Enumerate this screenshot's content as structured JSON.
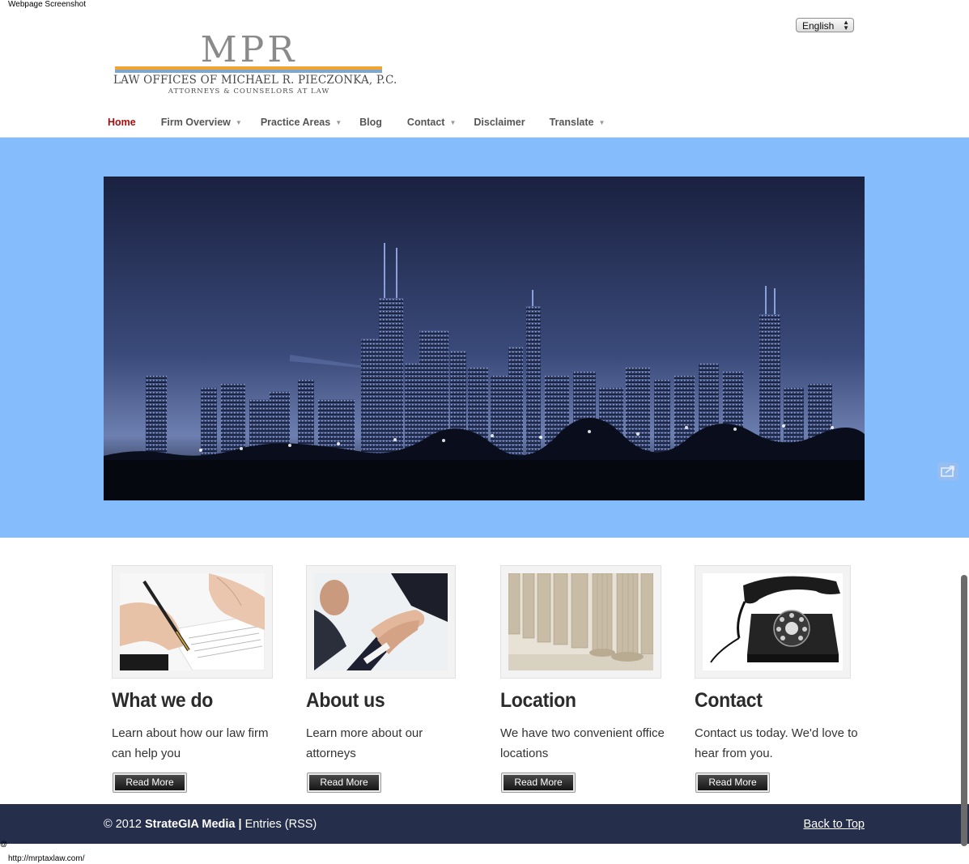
{
  "window": {
    "caption": "Webpage Screenshot",
    "url": "http://mrptaxlaw.com/"
  },
  "logo": {
    "mark": "MPR",
    "line1": "LAW OFFICES OF MICHAEL R. PIECZONKA, P.C.",
    "line2": "ATTORNEYS & COUNSELORS AT LAW",
    "colors": {
      "mark": "#8a8a8a",
      "orange_bar": "#f0a531",
      "blue_bar": "#7fa7cf"
    }
  },
  "language": {
    "selected": "English"
  },
  "nav": {
    "items": [
      {
        "label": "Home",
        "active": true,
        "dropdown": false
      },
      {
        "label": "Firm Overview",
        "active": false,
        "dropdown": true
      },
      {
        "label": "Practice Areas",
        "active": false,
        "dropdown": true
      },
      {
        "label": "Blog",
        "active": false,
        "dropdown": false
      },
      {
        "label": "Contact",
        "active": false,
        "dropdown": true
      },
      {
        "label": "Disclaimer",
        "active": false,
        "dropdown": false
      },
      {
        "label": "Translate",
        "active": false,
        "dropdown": true
      }
    ]
  },
  "hero": {
    "background": "#84bcfc",
    "image": "city-skyline-at-night"
  },
  "cards": [
    {
      "title": "What we do",
      "text": "Learn about how our law firm can help you",
      "button": "Read More",
      "image": "signing-document"
    },
    {
      "title": "About us",
      "text": "Learn more about our attorneys",
      "button": "Read More",
      "image": "handshake"
    },
    {
      "title": "Location",
      "text": "We have two convenient office locations",
      "button": "Read More",
      "image": "columns"
    },
    {
      "title": "Contact",
      "text": "Contact us today. We'd love to hear from you.",
      "button": "Read More",
      "image": "rotary-telephone"
    }
  ],
  "footer": {
    "copyright": "© 2012",
    "company": "StrateGIA Media",
    "separator": "|",
    "entries": "Entries (RSS)",
    "back_to_top": "Back to Top",
    "background": "#252f4c"
  }
}
